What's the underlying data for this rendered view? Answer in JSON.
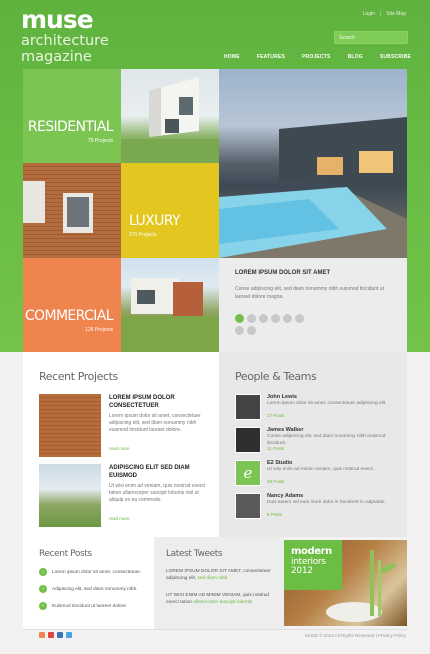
{
  "brand": {
    "name": "muse",
    "tagline": "architecture magazine"
  },
  "top_links": [
    "Login",
    "Site Map"
  ],
  "search": {
    "placeholder": "Search"
  },
  "nav": [
    "HOME",
    "FEATURES",
    "PROJECTS",
    "BLOG",
    "SUBSCRIBE"
  ],
  "tiles": {
    "residential": {
      "title": "RESIDENTIAL",
      "count": "75 Projects",
      "color": "#7cc552"
    },
    "luxury": {
      "title": "LUXURY",
      "count": "270 Projects",
      "color": "#e3c61f"
    },
    "commercial": {
      "title": "COMMERCIAL",
      "count": "126 Projects",
      "color": "#f0844f"
    }
  },
  "slider": {
    "heading": "LOREM IPSUM DOLOR SIT AMET",
    "text": "Conse adipiscing elit, sed diam nonummy nibh euismod tincidunt ut laoreet dolore magna.",
    "active_index": 0,
    "total_slides": 8
  },
  "recent_projects": {
    "title": "Recent Projects",
    "items": [
      {
        "title": "LOREM IPSUM DOLOR CONSECTETUER",
        "text": "Lorem ipsum dolor sit amet, consectetuer adipiscing elit, sed diam nonummy nibh euismod tincidunt laoreet dolore.",
        "more": "read more"
      },
      {
        "title": "ADIPISCING ELIT SED DIAM EUISMOD",
        "text": "Ut wisi enim ad veniam, quis nostrud exerci tation ullamcorper suscipit lobortis nisl ut aliquip ex ea commodo.",
        "more": "read more"
      }
    ]
  },
  "people": {
    "title": "People & Teams",
    "items": [
      {
        "name": "John Lewis",
        "text": "Lorem ipsum dolor sit amet, consectetuer adipiscing elit.",
        "count": "17 Posts"
      },
      {
        "name": "James Walker",
        "text": "Conse adipiscing elit, sed diam nonummy nibh euismod tincidunt.",
        "count": "11 Posts"
      },
      {
        "name": "E2 Studio",
        "text": "Ut wisi enim ad minim veniam, quis nostrud exerci.",
        "count": "48 Posts"
      },
      {
        "name": "Nancy Adams",
        "text": "Duis autem vel eum iriure dolor in hendrerit in vulputate.",
        "count": "5 Posts"
      }
    ]
  },
  "recent_posts": {
    "title": "Recent Posts",
    "items": [
      "Lorem ipsum dolor sit amet, consectetuer.",
      "Adipiscing elit, sed diam nonummy nibh.",
      "Euismod tincidunt ut laoreet dolore."
    ]
  },
  "tweets": {
    "title": "Latest Tweets",
    "items": [
      {
        "text": "LOREM IPSUM DOLOR SIT AMET, consectetuer adipiscing elit,",
        "link": "sed diam nibh"
      },
      {
        "text": "UT WISI ENIM AD MINIM VENIAM, quis nostrud exerci tation",
        "link": "ullamcorper suscipit lobortis"
      }
    ]
  },
  "promo": {
    "line1": "modern",
    "line2": "interiors",
    "line3": "2012"
  },
  "social": {
    "colors": [
      "#f0844f",
      "#e0453a",
      "#3b73b9",
      "#4aa6dc"
    ]
  },
  "footer": {
    "copyright": "MUSE © 2012 All Rights Reserved  |  Privacy Policy"
  }
}
